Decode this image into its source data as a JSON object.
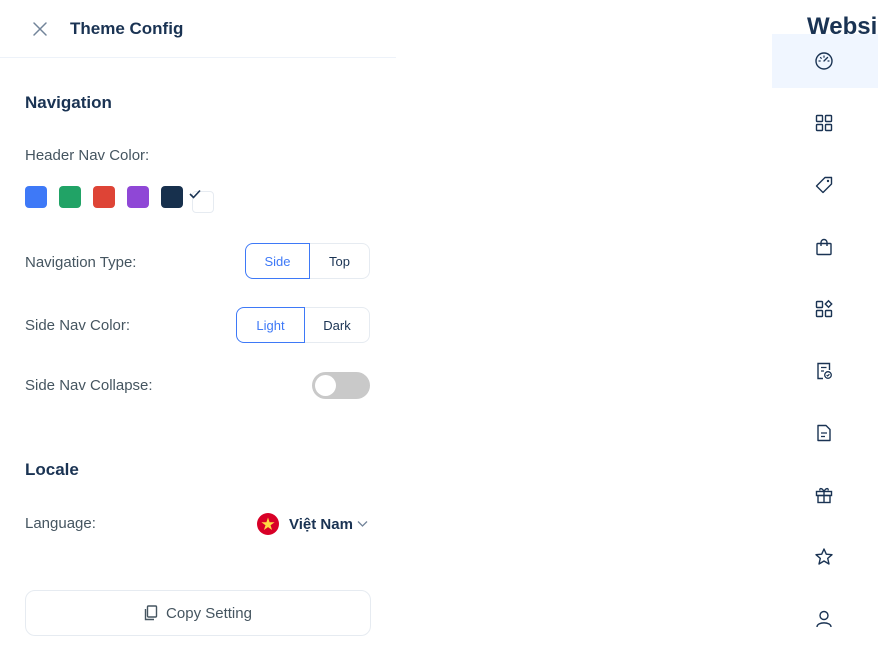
{
  "drawer": {
    "title": "Theme Config",
    "navigation": {
      "section_title": "Navigation",
      "header_nav_color_label": "Header Nav Color:",
      "colors": [
        "#3e79f7",
        "#21a366",
        "#de4436",
        "#8f47d6",
        "#17304d",
        "#ffffff"
      ],
      "selected_color": "#ffffff",
      "navigation_type_label": "Navigation Type:",
      "navigation_type_options": [
        "Side",
        "Top"
      ],
      "navigation_type_selected": "Side",
      "side_nav_color_label": "Side Nav Color:",
      "side_nav_color_options": [
        "Light",
        "Dark"
      ],
      "side_nav_color_selected": "Light",
      "side_nav_collapse_label": "Side Nav Collapse:",
      "side_nav_collapse_on": false
    },
    "locale": {
      "section_title": "Locale",
      "language_label": "Language:",
      "language_value": "Việt Nam"
    },
    "copy_button_label": "Copy Setting"
  },
  "page": {
    "title": "Websi"
  },
  "sidenav": {
    "items": [
      {
        "icon": "dashboard-icon",
        "active": true
      },
      {
        "icon": "grid-icon"
      },
      {
        "icon": "tag-icon"
      },
      {
        "icon": "shopping-bag-icon"
      },
      {
        "icon": "apps-icon"
      },
      {
        "icon": "order-icon"
      },
      {
        "icon": "file-text-icon"
      },
      {
        "icon": "gift-icon"
      },
      {
        "icon": "star-icon"
      },
      {
        "icon": "user-icon"
      }
    ]
  },
  "colors": {
    "primary": "#3e79f7",
    "heading": "#1a3353",
    "text": "#455560",
    "border": "#e6ebf1",
    "toggle_off": "#c9c9c9",
    "nav_active_bg": "#f0f6ff"
  }
}
